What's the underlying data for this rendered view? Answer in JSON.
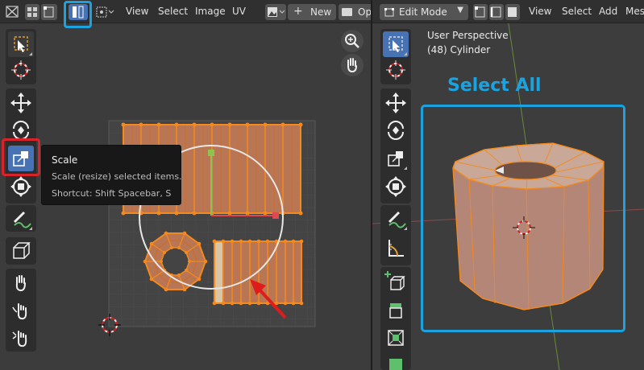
{
  "uv_editor": {
    "header": {
      "menus": [
        "View",
        "Select",
        "Image",
        "UV"
      ],
      "new_label": "New",
      "open_label": "Ope",
      "plus_glyph": "+"
    },
    "tooltip": {
      "title": "Scale",
      "description": "Scale (resize) selected items.",
      "shortcut": "Shortcut: Shift Spacebar, S"
    },
    "tools": [
      "select-box",
      "cursor",
      "move",
      "rotate",
      "scale",
      "transform",
      "annotate",
      "transform-box",
      "grab",
      "relax",
      "pinch"
    ],
    "active_tool": "scale"
  },
  "viewport_3d": {
    "header": {
      "mode_label": "Edit Mode",
      "menus": [
        "View",
        "Select",
        "Add",
        "Mesh"
      ]
    },
    "view_name": "User Perspective",
    "object_info": "(48) Cylinder",
    "annotation": "Select All",
    "tools": [
      "select-box",
      "cursor",
      "move",
      "rotate",
      "scale",
      "transform",
      "annotate",
      "measure",
      "add-cube",
      "extrude",
      "inset"
    ]
  },
  "colors": {
    "highlight_blue": "#1aa3e0",
    "highlight_red": "#d8232a",
    "active_tool": "#4772b3",
    "mesh_orange": "#f5891b",
    "mesh_face": "#b87654"
  }
}
